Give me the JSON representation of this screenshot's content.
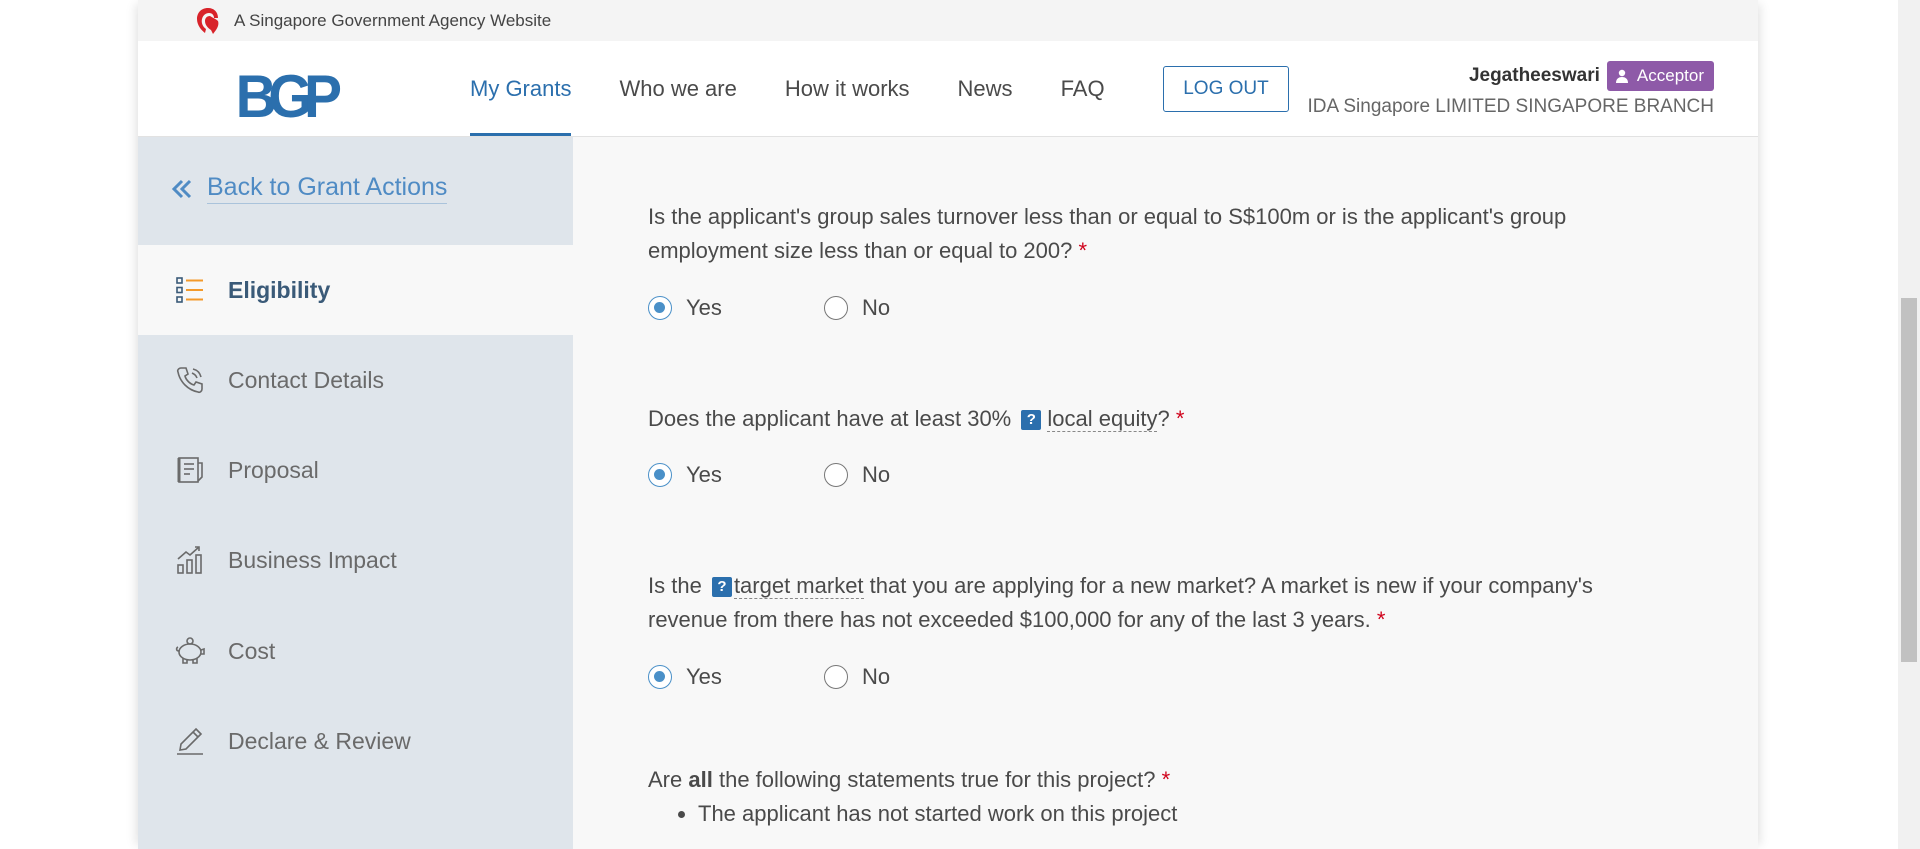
{
  "gov_banner": {
    "text": "A Singapore Government Agency Website",
    "icon": "lion-head-icon"
  },
  "header": {
    "logo_text": "BGP",
    "nav": [
      {
        "label": "My Grants",
        "active": true
      },
      {
        "label": "Who we are",
        "active": false
      },
      {
        "label": "How it works",
        "active": false
      },
      {
        "label": "News",
        "active": false
      },
      {
        "label": "FAQ",
        "active": false
      }
    ],
    "logout_label": "LOG OUT",
    "user_name": "Jegatheeswari",
    "role": "Acceptor",
    "company": "IDA Singapore LIMITED SINGAPORE BRANCH"
  },
  "sidebar": {
    "back_label": "Back to Grant Actions",
    "items": [
      {
        "label": "Eligibility",
        "icon": "list-icon",
        "active": true
      },
      {
        "label": "Contact Details",
        "icon": "phone-icon",
        "active": false
      },
      {
        "label": "Proposal",
        "icon": "document-icon",
        "active": false
      },
      {
        "label": "Business Impact",
        "icon": "growth-chart-icon",
        "active": false
      },
      {
        "label": "Cost",
        "icon": "piggy-bank-icon",
        "active": false
      },
      {
        "label": "Declare & Review",
        "icon": "pen-signature-icon",
        "active": false
      }
    ]
  },
  "questions": {
    "q1": {
      "line1": "Is the applicant's group sales turnover less than or equal to S$100m or is the applicant's group",
      "line2": "employment size less than or equal to 200?",
      "required": "*",
      "selected": "Yes"
    },
    "q2": {
      "text_before": "Does the applicant have at least 30%",
      "tooltip_marker": "?",
      "term": "local equity",
      "text_after": "?",
      "required": "*",
      "selected": "Yes"
    },
    "q3": {
      "text_before": "Is the",
      "tooltip_marker": "?",
      "term": "target market",
      "text_after": "that you are applying for a new market? A market is new if your company's",
      "line2": "revenue from there has not exceeded $100,000 for any of the last 3 years.",
      "required": "*",
      "selected": "Yes"
    },
    "q4": {
      "text_before": "Are",
      "bold": "all",
      "text_after": "the following statements true for this project?",
      "required": "*",
      "statements": [
        "The applicant has not started work on this project"
      ]
    },
    "options": {
      "yes": "Yes",
      "no": "No"
    }
  }
}
